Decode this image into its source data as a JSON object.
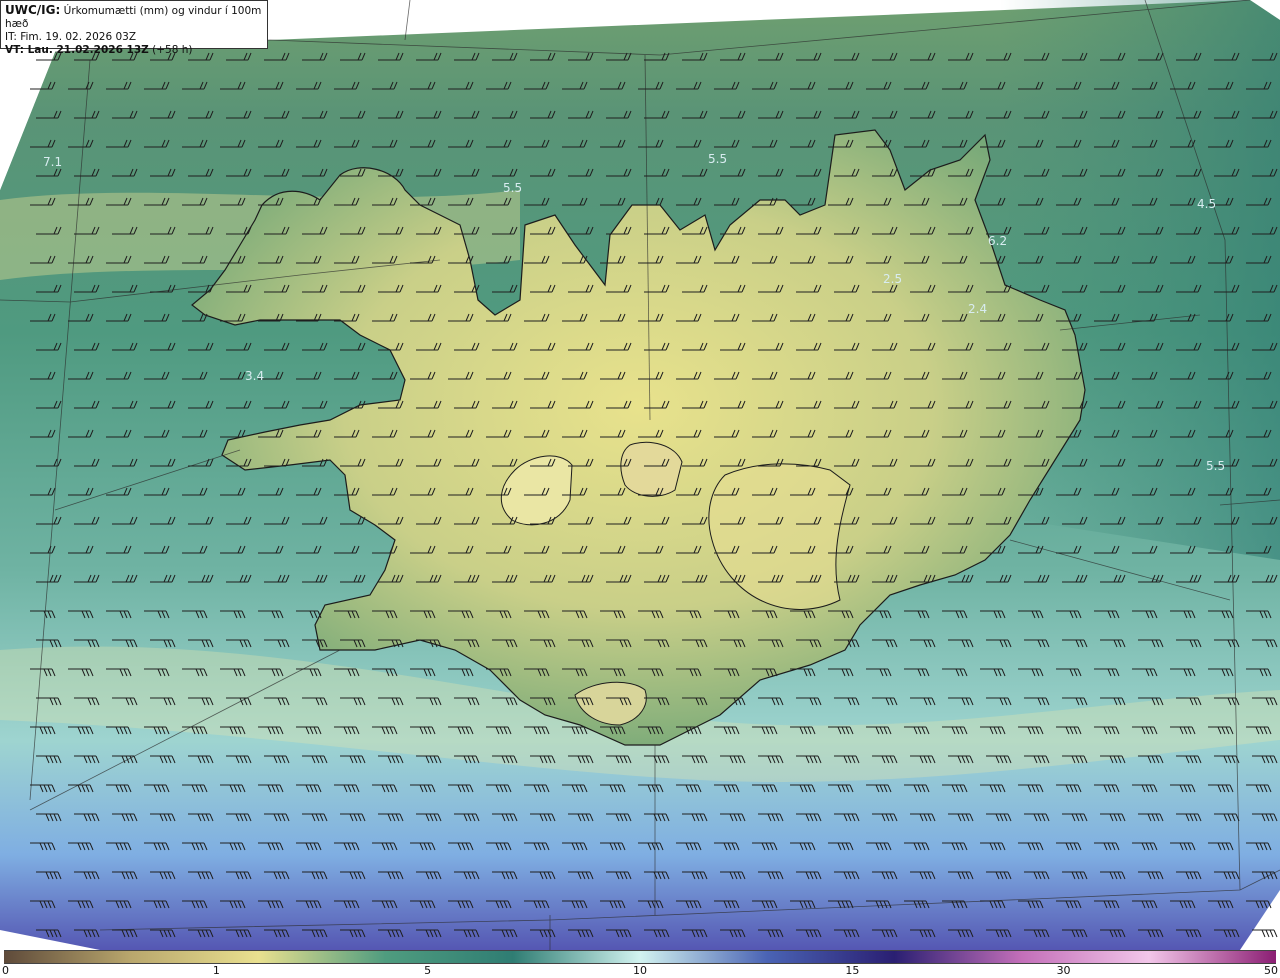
{
  "header": {
    "product": "UWC/IG:",
    "title": "Úrkomumætti (mm) og vindur í 100m hæð",
    "init_time": "IT: Fim. 19. 02. 2026 03Z",
    "valid_label": "VT: Lau. 21.02.2026 13Z",
    "lead_time": "(+58 h)"
  },
  "map_values": [
    {
      "id": "nw-sea",
      "text": "7.1"
    },
    {
      "id": "north-west",
      "text": "5.5"
    },
    {
      "id": "north-central",
      "text": "5.5"
    },
    {
      "id": "north-east-sea",
      "text": "4.5"
    },
    {
      "id": "east-coast",
      "text": "6.2"
    },
    {
      "id": "ne-interior",
      "text": "2.5"
    },
    {
      "id": "east-interior",
      "text": "2.4"
    },
    {
      "id": "west-fjords-south",
      "text": "3.4"
    },
    {
      "id": "east-sea",
      "text": "5.5"
    }
  ],
  "colorbar": {
    "ticks": [
      {
        "label": "0",
        "pos": 0.0
      },
      {
        "label": "1",
        "pos": 0.167
      },
      {
        "label": "5",
        "pos": 0.333
      },
      {
        "label": "10",
        "pos": 0.5
      },
      {
        "label": "15",
        "pos": 0.667
      },
      {
        "label": "30",
        "pos": 0.833
      },
      {
        "label": "50",
        "pos": 1.0
      }
    ],
    "colors": [
      "#5e4a3a",
      "#b9a76d",
      "#e9e08f",
      "#4f9c7f",
      "#2f7d73",
      "#d2f3f0",
      "#4a63b4",
      "#2a1f72",
      "#c36fb9",
      "#f2c6e9",
      "#8b1e73"
    ]
  }
}
